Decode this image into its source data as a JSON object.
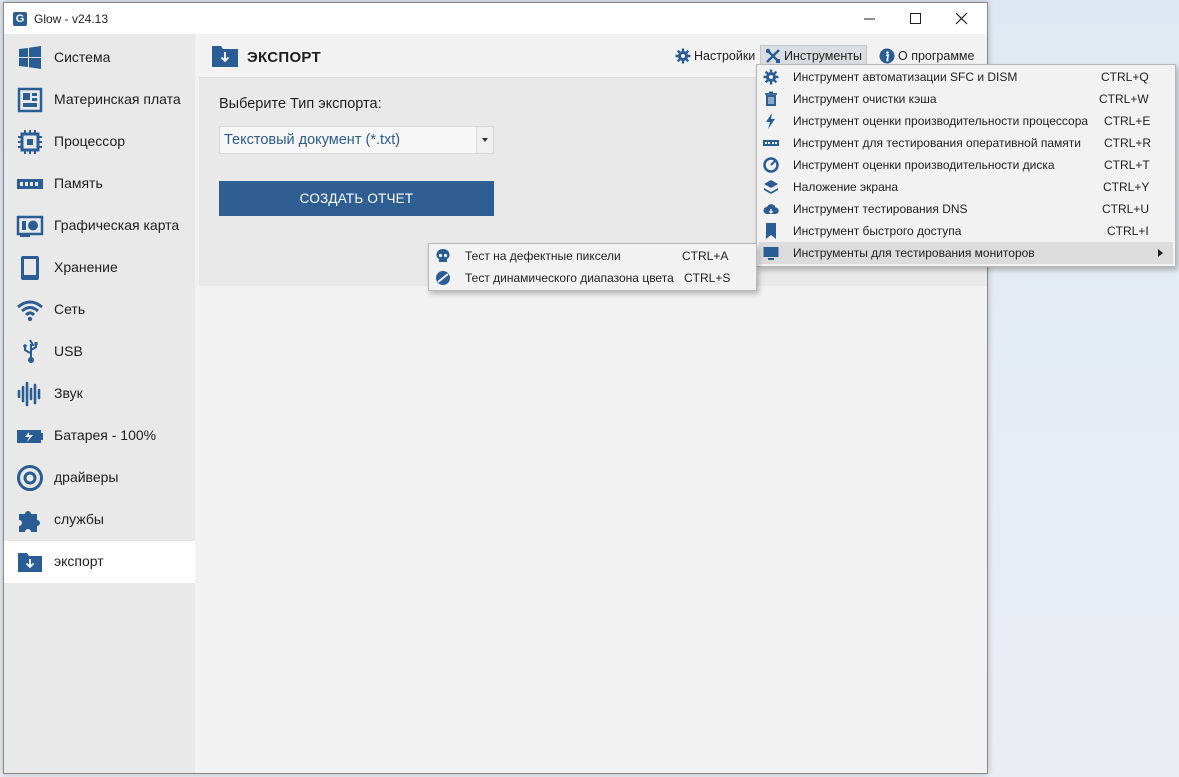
{
  "window": {
    "title": "Glow - v24.13",
    "logo_letter": "G"
  },
  "sidebar": {
    "items": [
      {
        "label": "Система",
        "icon": "windows-icon"
      },
      {
        "label": "Материнская плата",
        "icon": "motherboard-icon"
      },
      {
        "label": "Процессор",
        "icon": "cpu-icon"
      },
      {
        "label": "Память",
        "icon": "ram-icon"
      },
      {
        "label": "Графическая карта",
        "icon": "gpu-icon"
      },
      {
        "label": "Хранение",
        "icon": "storage-icon"
      },
      {
        "label": "Сеть",
        "icon": "wifi-icon"
      },
      {
        "label": "USB",
        "icon": "usb-icon"
      },
      {
        "label": "Звук",
        "icon": "sound-wave-icon"
      },
      {
        "label": "Батарея - 100%",
        "icon": "battery-icon"
      },
      {
        "label": "драйверы",
        "icon": "disc-icon"
      },
      {
        "label": "службы",
        "icon": "puzzle-icon"
      },
      {
        "label": "экспорт",
        "icon": "export-folder-icon"
      }
    ],
    "active_index": 12
  },
  "header": {
    "title": "ЭКСПОРТ",
    "settings_label": "Настройки",
    "tools_label": "Инструменты",
    "about_label": "О программе"
  },
  "export": {
    "label": "Выберите Тип экспорта:",
    "selected_type": "Текстовый документ (*.txt)",
    "create_button": "СОЗДАТЬ ОТЧЕТ"
  },
  "tools_menu": {
    "items": [
      {
        "label": "Инструмент автоматизации SFC и DISM",
        "shortcut": "CTRL+Q",
        "icon": "gear-shield-icon"
      },
      {
        "label": "Инструмент очистки кэша",
        "shortcut": "CTRL+W",
        "icon": "trash-icon"
      },
      {
        "label": "Инструмент оценки производительности процессора",
        "shortcut": "CTRL+E",
        "icon": "bolt-icon"
      },
      {
        "label": "Инструмент для тестирования оперативной памяти",
        "shortcut": "CTRL+R",
        "icon": "memory-icon"
      },
      {
        "label": "Инструмент оценки производительности диска",
        "shortcut": "CTRL+T",
        "icon": "gauge-icon"
      },
      {
        "label": "Наложение экрана",
        "shortcut": "CTRL+Y",
        "icon": "layers-icon"
      },
      {
        "label": "Инструмент тестирования DNS",
        "shortcut": "CTRL+U",
        "icon": "cloud-icon"
      },
      {
        "label": "Инструмент быстрого доступа",
        "shortcut": "CTRL+I",
        "icon": "bookmark-icon"
      },
      {
        "label": "Инструменты для тестирования мониторов",
        "shortcut": "",
        "icon": "monitor-icon",
        "submenu": true
      }
    ]
  },
  "monitor_submenu": {
    "items": [
      {
        "label": "Тест на дефектные пиксели",
        "shortcut": "CTRL+A",
        "icon": "skull-icon"
      },
      {
        "label": "Тест динамического диапазона цвета",
        "shortcut": "CTRL+S",
        "icon": "palette-icon"
      }
    ]
  },
  "colors": {
    "accent": "#2e5e92",
    "icon": "#2a5d94"
  }
}
